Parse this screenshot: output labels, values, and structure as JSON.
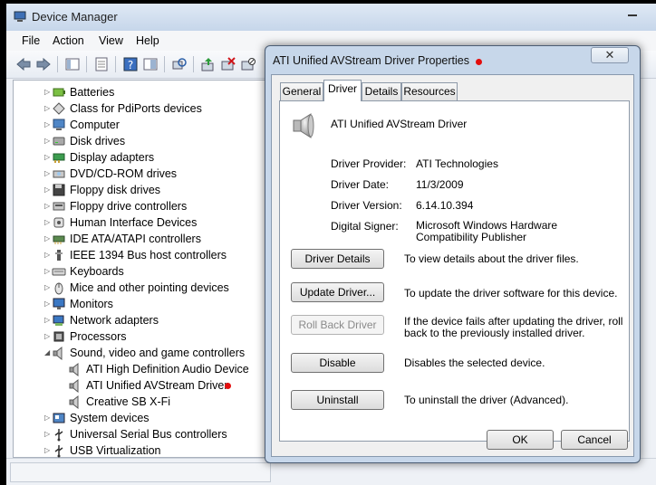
{
  "main_window": {
    "title": "Device Manager",
    "menu": [
      "File",
      "Action",
      "View",
      "Help"
    ]
  },
  "tree": [
    {
      "label": "Batteries",
      "icon": "battery-icon",
      "state": "collapsed"
    },
    {
      "label": "Class for PdiPorts devices",
      "icon": "diamond-device-icon",
      "state": "collapsed"
    },
    {
      "label": "Computer",
      "icon": "computer-icon",
      "state": "collapsed"
    },
    {
      "label": "Disk drives",
      "icon": "disk-drive-icon",
      "state": "collapsed"
    },
    {
      "label": "Display adapters",
      "icon": "display-adapter-icon",
      "state": "collapsed"
    },
    {
      "label": "DVD/CD-ROM drives",
      "icon": "dvd-drive-icon",
      "state": "collapsed"
    },
    {
      "label": "Floppy disk drives",
      "icon": "floppy-disk-icon",
      "state": "collapsed"
    },
    {
      "label": "Floppy drive controllers",
      "icon": "floppy-controller-icon",
      "state": "collapsed"
    },
    {
      "label": "Human Interface Devices",
      "icon": "hid-icon",
      "state": "collapsed"
    },
    {
      "label": "IDE ATA/ATAPI controllers",
      "icon": "ide-controller-icon",
      "state": "collapsed"
    },
    {
      "label": "IEEE 1394 Bus host controllers",
      "icon": "ieee1394-icon",
      "state": "collapsed"
    },
    {
      "label": "Keyboards",
      "icon": "keyboard-icon",
      "state": "collapsed"
    },
    {
      "label": "Mice and other pointing devices",
      "icon": "mouse-icon",
      "state": "collapsed"
    },
    {
      "label": "Monitors",
      "icon": "monitor-icon",
      "state": "collapsed"
    },
    {
      "label": "Network adapters",
      "icon": "network-adapter-icon",
      "state": "collapsed"
    },
    {
      "label": "Processors",
      "icon": "processor-icon",
      "state": "collapsed"
    },
    {
      "label": "Sound, video and game controllers",
      "icon": "speaker-icon",
      "state": "expanded"
    },
    {
      "label": "ATI High Definition Audio Device",
      "icon": "speaker-icon",
      "state": "child"
    },
    {
      "label": "ATI Unified AVStream Driver",
      "icon": "speaker-icon",
      "state": "child",
      "marked": true
    },
    {
      "label": "Creative SB X-Fi",
      "icon": "speaker-icon",
      "state": "child"
    },
    {
      "label": "System devices",
      "icon": "system-device-icon",
      "state": "collapsed"
    },
    {
      "label": "Universal Serial Bus controllers",
      "icon": "usb-icon",
      "state": "collapsed"
    },
    {
      "label": "USB Virtualization",
      "icon": "usb-icon",
      "state": "collapsed"
    }
  ],
  "dialog": {
    "title": "ATI Unified AVStream Driver Properties",
    "close_label": "✕",
    "tabs": [
      "General",
      "Driver",
      "Details",
      "Resources"
    ],
    "active_tab": "Driver",
    "device_name": "ATI Unified AVStream Driver",
    "fields": [
      {
        "label": "Driver Provider:",
        "value": "ATI Technologies"
      },
      {
        "label": "Driver Date:",
        "value": "11/3/2009"
      },
      {
        "label": "Driver Version:",
        "value": "6.14.10.394"
      },
      {
        "label": "Digital Signer:",
        "value": "Microsoft Windows Hardware Compatibility Publisher"
      }
    ],
    "actions": [
      {
        "label": "Driver Details",
        "description": "To view details about the driver files.",
        "enabled": true
      },
      {
        "label": "Update Driver...",
        "description": "To update the driver software for this device.",
        "enabled": true
      },
      {
        "label": "Roll Back Driver",
        "description": "If the device fails after updating the driver, roll back to the previously installed driver.",
        "enabled": false
      },
      {
        "label": "Disable",
        "description": "Disables the selected device.",
        "enabled": true
      },
      {
        "label": "Uninstall",
        "description": "To uninstall the driver (Advanced).",
        "enabled": true
      }
    ],
    "ok_label": "OK",
    "cancel_label": "Cancel"
  },
  "colors": {
    "marker_dot": "#e30d0d",
    "dialog_frame": "#c7d7ea"
  }
}
